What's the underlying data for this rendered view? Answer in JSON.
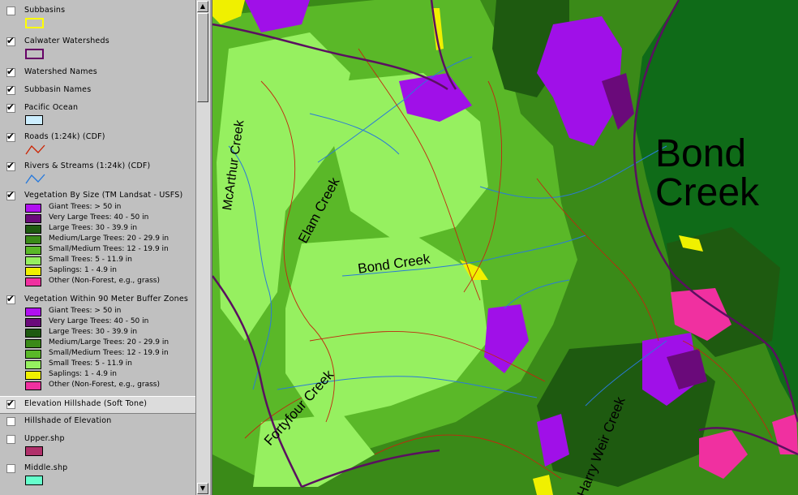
{
  "legend": {
    "layers": [
      {
        "name": "Subbasins",
        "checked": false,
        "symbol": "box",
        "color": "#ffff00"
      },
      {
        "name": "Calwater Watersheds",
        "checked": true,
        "symbol": "box",
        "color": "#660066"
      },
      {
        "name": "Watershed Names",
        "checked": true
      },
      {
        "name": "Subbasin Names",
        "checked": true
      },
      {
        "name": "Pacific Ocean",
        "checked": true,
        "symbol": "fill",
        "color": "#cceeff"
      },
      {
        "name": "Roads (1:24k) (CDF)",
        "checked": true,
        "symbol": "line",
        "color": "#cc2200"
      },
      {
        "name": "Rivers & Streams (1:24k) (CDF)",
        "checked": true,
        "symbol": "line",
        "color": "#2277dd"
      },
      {
        "name": "Vegetation By Size (TM Landsat - USFS)",
        "checked": true,
        "classes": [
          {
            "label": "Giant Trees: > 50 in",
            "color": "#b010f0"
          },
          {
            "label": "Very Large Trees: 40 - 50 in",
            "color": "#6a0a7a"
          },
          {
            "label": "Large Trees: 30 - 39.9 in",
            "color": "#1e5a10"
          },
          {
            "label": "Medium/Large Trees: 20 - 29.9 in",
            "color": "#3a8a18"
          },
          {
            "label": "Small/Medium Trees: 12 - 19.9 in",
            "color": "#5ab828"
          },
          {
            "label": "Small Trees: 5 - 11.9 in",
            "color": "#96f060"
          },
          {
            "label": "Saplings: 1 - 4.9 in",
            "color": "#f0f000"
          },
          {
            "label": "Other (Non-Forest, e.g., grass)",
            "color": "#f030a0"
          }
        ]
      },
      {
        "name": "Vegetation Within 90 Meter Buffer Zones",
        "checked": true,
        "classes": [
          {
            "label": "Giant Trees: > 50 in",
            "color": "#b010f0"
          },
          {
            "label": "Very Large Trees: 40 - 50 in",
            "color": "#6a0a7a"
          },
          {
            "label": "Large Trees: 30 - 39.9 in",
            "color": "#1e5a10"
          },
          {
            "label": "Medium/Large Trees: 20 - 29.9 in",
            "color": "#3a8a18"
          },
          {
            "label": "Small/Medium Trees: 12 - 19.9 in",
            "color": "#5ab828"
          },
          {
            "label": "Small Trees: 5 - 11.9 in",
            "color": "#96f060"
          },
          {
            "label": "Saplings: 1 - 4.9 in",
            "color": "#f0f000"
          },
          {
            "label": "Other (Non-Forest, e.g., grass)",
            "color": "#f030a0"
          }
        ]
      },
      {
        "name": "Elevation Hillshade (Soft Tone)",
        "checked": true,
        "active": true
      },
      {
        "name": "Hillshade of Elevation",
        "checked": false
      },
      {
        "name": "Upper.shp",
        "checked": false,
        "symbol": "fill",
        "color": "#b0306a"
      },
      {
        "name": "Middle.shp",
        "checked": false,
        "symbol": "fill",
        "color": "#66ffcc"
      }
    ]
  },
  "map": {
    "labels": {
      "watershed": [
        "Bond",
        "Creek"
      ],
      "mcarthur": "McArthur Creek",
      "elam": "Elam Creek",
      "bond": "Bond Creek",
      "fortyfour": "Fortyfour Creek",
      "harry": "Harry Weir Creek"
    },
    "colors": {
      "outside": "#0f6b18",
      "road": "#c02810",
      "stream": "#2a7ad8",
      "boundary": "#5a1060",
      "sapling": "#f0f000",
      "nonforest": "#f030a0",
      "giant": "#a010e8"
    }
  }
}
